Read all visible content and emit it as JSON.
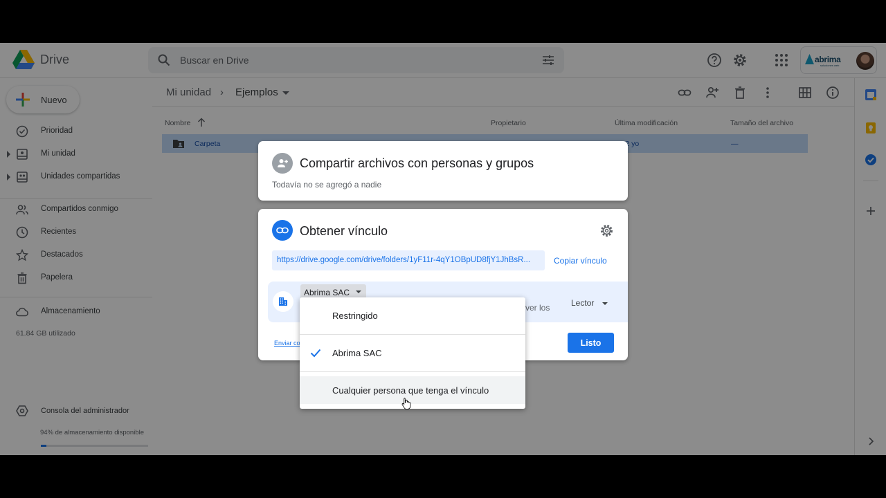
{
  "app": {
    "name": "Drive"
  },
  "search": {
    "placeholder": "Buscar en Drive"
  },
  "brand": {
    "name": "abrima",
    "tagline": "soluciones web"
  },
  "sidebar": {
    "new_label": "Nuevo",
    "items": [
      {
        "label": "Prioridad"
      },
      {
        "label": "Mi unidad"
      },
      {
        "label": "Unidades compartidas"
      },
      {
        "label": "Compartidos conmigo"
      },
      {
        "label": "Recientes"
      },
      {
        "label": "Destacados"
      },
      {
        "label": "Papelera"
      },
      {
        "label": "Almacenamiento"
      }
    ],
    "storage_used": "61.84 GB utilizado",
    "admin_label": "Consola del administrador",
    "available": "94% de almacenamiento disponible",
    "available_fraction": 0.05
  },
  "breadcrumb": {
    "root": "Mi unidad",
    "separator": "›",
    "current": "Ejemplos"
  },
  "table": {
    "columns": [
      "Nombre",
      "Propietario",
      "Última modificación",
      "Tamaño del archivo"
    ],
    "rows": [
      {
        "name": "Carpeta",
        "modified": "…22 yo",
        "size": "—"
      }
    ]
  },
  "share_dialog": {
    "title": "Compartir archivos con personas y grupos",
    "subtitle": "Todavía no se agregó a nadie"
  },
  "link_dialog": {
    "title": "Obtener vínculo",
    "url": "https://drive.google.com/drive/folders/1yF11r-4qY1OBpUD8fjY1JhBsR...",
    "copy_label": "Copiar vínculo",
    "access_selected": "Abrima SAC",
    "description_tail": "ver los",
    "role": "Lector",
    "send_label": "Enviar co",
    "done_label": "Listo"
  },
  "access_menu": {
    "options": [
      {
        "label": "Restringido",
        "selected": false
      },
      {
        "label": "Abrima SAC",
        "selected": true
      },
      {
        "label": "Cualquier persona que tenga el vínculo",
        "selected": false
      }
    ]
  },
  "colors": {
    "accent": "#1a73e8",
    "selection": "#c2dbfa"
  }
}
